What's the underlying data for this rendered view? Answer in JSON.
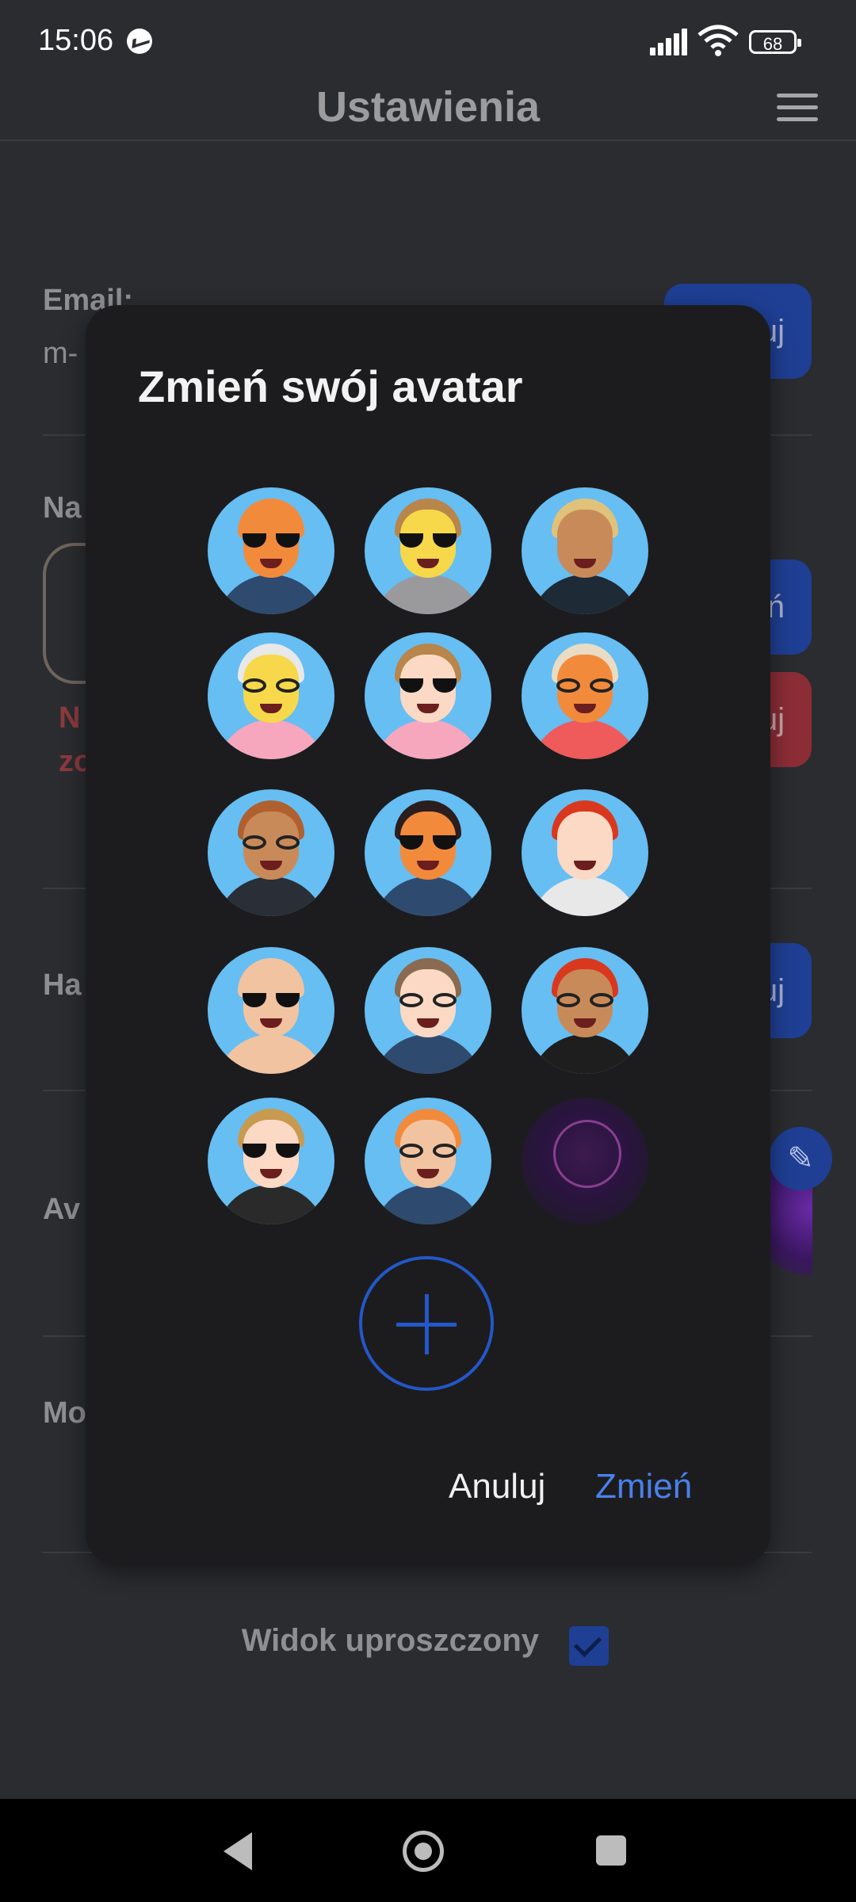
{
  "status_bar": {
    "time": "15:06",
    "battery": "68"
  },
  "header": {
    "title": "Ustawienia"
  },
  "background": {
    "email_label": "Email:",
    "email_value": "m-",
    "name_label": "Na",
    "error_line1": "N",
    "error_line2": "zo",
    "password_label": "Ha",
    "avatar_label": "Av",
    "mode_label": "Mo",
    "btn_email": "uj",
    "btn_name": "ń",
    "btn_delete": "uj",
    "btn_password": "uj",
    "simple_view_label": "Widok uproszczony",
    "simple_view_checked": true
  },
  "dialog": {
    "title": "Zmień swój avatar",
    "cancel_label": "Anuluj",
    "confirm_label": "Zmień",
    "avatars": [
      {
        "name": "avatar-bald-sunglasses"
      },
      {
        "name": "avatar-yellow-sunglasses"
      },
      {
        "name": "avatar-blond-man"
      },
      {
        "name": "avatar-white-hair-woman"
      },
      {
        "name": "avatar-brown-hair-woman"
      },
      {
        "name": "avatar-blond-woman-glasses"
      },
      {
        "name": "avatar-bearded-man-glasses"
      },
      {
        "name": "avatar-black-hair-woman"
      },
      {
        "name": "avatar-red-hair-woman"
      },
      {
        "name": "avatar-bald-bearded-man"
      },
      {
        "name": "avatar-mustache-man"
      },
      {
        "name": "avatar-red-hair-man"
      },
      {
        "name": "avatar-curly-hair-woman"
      },
      {
        "name": "avatar-old-bearded-man"
      },
      {
        "name": "avatar-cosmic-custom"
      }
    ]
  }
}
